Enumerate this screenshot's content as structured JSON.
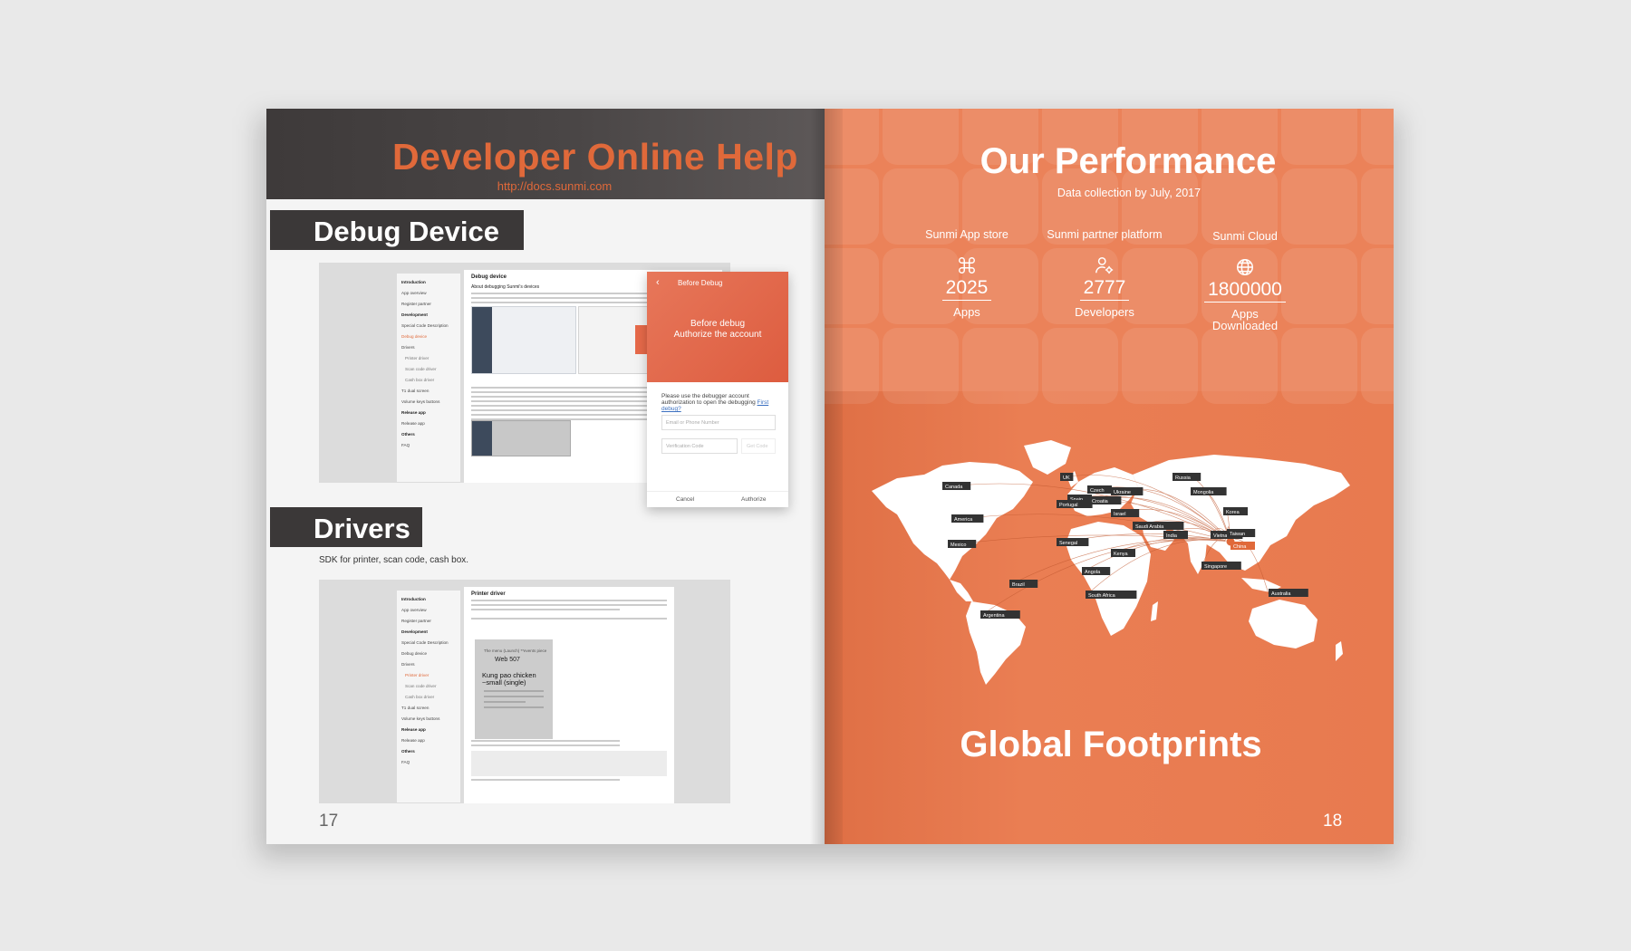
{
  "left_page": {
    "title": "Developer Online Help",
    "url": "http://docs.sunmi.com",
    "section1": "Debug Device",
    "section2": "Drivers",
    "drivers_desc": "SDK for printer, scan code, cash box.",
    "page_number": "17",
    "nav1": [
      "Introduction",
      "App overview",
      "Register partner",
      "Development",
      "Special Code Description",
      "Debug device",
      "Drivers",
      "Printer driver",
      "Scan code driver",
      "Cash box driver",
      "T1 dual screen",
      "Volume keys buttons",
      "Release app",
      "Release app",
      "Others",
      "FAQ"
    ],
    "nav2": [
      "Introduction",
      "App overview",
      "Register partner",
      "Development",
      "Special Code Description",
      "Debug device",
      "Drivers",
      "Printer driver",
      "Scan code driver",
      "Cash box driver",
      "T1 dual screen",
      "Volume keys buttons",
      "Release app",
      "Release app",
      "Others",
      "FAQ"
    ],
    "shot1_title": "Debug device",
    "shot1_subtitle": "About debugging Sunmi's devices",
    "shot2_title": "Printer driver",
    "dialog": {
      "back": "‹",
      "title": "Before Debug",
      "hero_line1": "Before debug",
      "hero_line2": "Authorize the account",
      "message": "Please use the debugger account authorization to open the debugging",
      "link": "First debug?",
      "email_placeholder": "Email or Phone Number",
      "code_placeholder": "Verification Code",
      "get_code": "Get Code",
      "cancel": "Cancel",
      "authorize": "Authorize"
    },
    "receipt": {
      "line1": "The menu (Launch) **events piece",
      "web": "Web 507",
      "item": "Kung pao chicken ~small (single)"
    }
  },
  "right_page": {
    "title": "Our Performance",
    "subtitle": "Data collection by July, 2017",
    "stats": [
      {
        "label": "Sunmi App store",
        "value": "2025",
        "unit": "Apps",
        "icon": "command-icon"
      },
      {
        "label": "Sunmi partner platform",
        "value": "2777",
        "unit": "Developers",
        "icon": "developer-gear-icon"
      },
      {
        "label": "Sunmi Cloud",
        "value": "1800000",
        "unit": "Apps Downloaded",
        "icon": "globe-icon"
      }
    ],
    "map_labels": [
      "Canada",
      "America",
      "Mexico",
      "Brazil",
      "Argentina",
      "UK",
      "Spain",
      "Portugal",
      "Czech",
      "Croatia",
      "Ukraine",
      "Israel",
      "Saudi Arabia",
      "Senegal",
      "Kenya",
      "Angola",
      "South Africa",
      "Russia",
      "Mongolia",
      "China",
      "Korea",
      "India",
      "Vietnam",
      "Taiwan",
      "Singapore",
      "Australia"
    ],
    "footer_title": "Global Footprints",
    "page_number": "18",
    "colors": {
      "accent": "#e0693a",
      "dark": "#3b3838",
      "right_bg": "#e87a4f"
    }
  }
}
